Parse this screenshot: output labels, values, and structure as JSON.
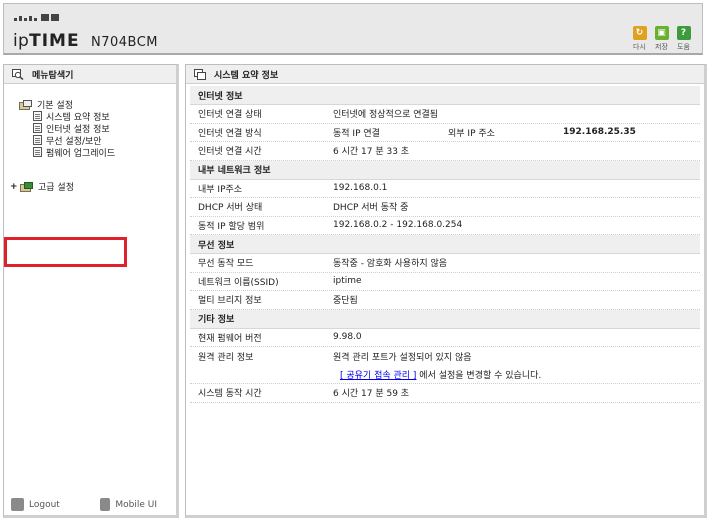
{
  "header": {
    "logo_prefix": "ip",
    "logo_brand": "TIME",
    "logo_model": "N704BCM",
    "buttons": [
      {
        "label": "다시",
        "icon": "refresh-icon",
        "color": "#e0a020"
      },
      {
        "label": "저장",
        "icon": "save-icon",
        "color": "#6ab030"
      },
      {
        "label": "도움",
        "icon": "help-icon",
        "color": "#3d9a3d"
      }
    ]
  },
  "sidebar": {
    "title": "메뉴탐색기",
    "basic": "기본 설정",
    "items": [
      "시스템 요약 정보",
      "인터넷 설정 정보",
      "무선 설정/보안",
      "펌웨어 업그레이드"
    ],
    "advanced_expander": "+",
    "advanced": "고급 설정",
    "logout": "Logout",
    "mobile": "Mobile UI"
  },
  "main": {
    "title": "시스템 요약 정보",
    "internet": {
      "title": "인터넷 정보",
      "rows": [
        {
          "k": "인터넷 연결 상태",
          "v": "인터넷에 정상적으로 연결됨"
        },
        {
          "k": "인터넷 연결 방식",
          "v": "동적 IP 연결",
          "k2": "외부 IP 주소",
          "v2": "192.168.25.35"
        },
        {
          "k": "인터넷 연결 시간",
          "v": "6 시간 17 분 33 초"
        }
      ]
    },
    "lan": {
      "title": "내부 네트워크 정보",
      "rows": [
        {
          "k": "내부 IP주소",
          "v": "192.168.0.1"
        },
        {
          "k": "DHCP 서버 상태",
          "v": "DHCP 서버 동작 중"
        },
        {
          "k": "동적 IP 할당 범위",
          "v": "192.168.0.2 -  192.168.0.254"
        }
      ]
    },
    "wireless": {
      "title": "무선 정보",
      "rows": [
        {
          "k": "무선 동작 모드",
          "v": "동작중 - 암호화 사용하지 않음"
        },
        {
          "k": "네트워크 이름(SSID)",
          "v": "iptime"
        },
        {
          "k": "멀티 브리지 정보",
          "v": "중단됨"
        }
      ]
    },
    "other": {
      "title": "기타 정보",
      "firmware_k": "현재 펌웨어 버전",
      "firmware_v": "9.98.0",
      "remote_k": "원격 관리 정보",
      "remote_v": "원격 관리 포트가 설정되어 있지 않음",
      "remote_link": "[ 공유기 접속 관리 ]",
      "remote_link_suffix": " 에서 설정을 변경할 수 있습니다.",
      "uptime_k": "시스템 동작 시간",
      "uptime_v": "6 시간 17 분 59 초"
    }
  }
}
